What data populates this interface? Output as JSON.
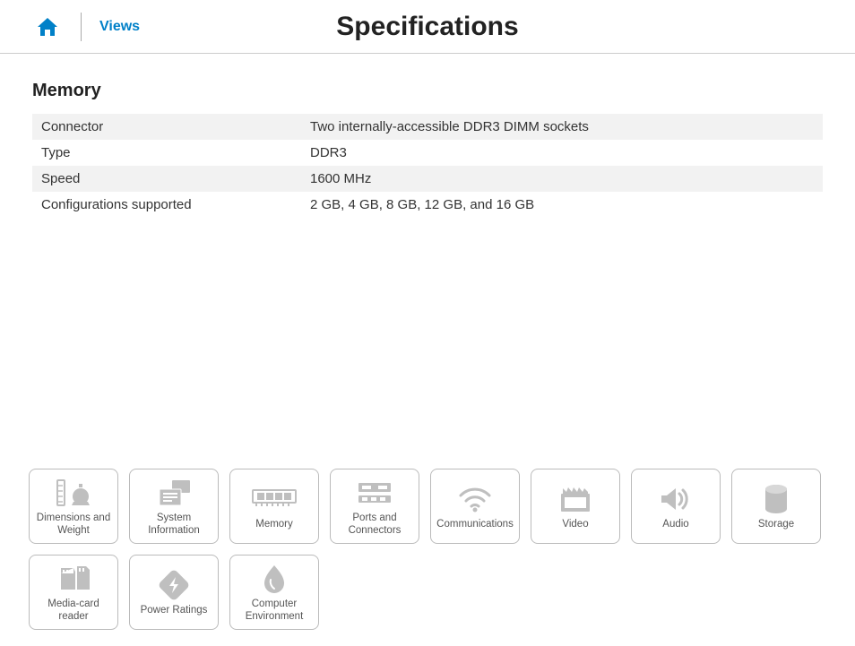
{
  "header": {
    "views_label": "Views",
    "title": "Specifications"
  },
  "section": {
    "title": "Memory",
    "rows": [
      {
        "label": "Connector",
        "value": "Two internally-accessible DDR3 DIMM sockets"
      },
      {
        "label": "Type",
        "value": "DDR3"
      },
      {
        "label": "Speed",
        "value": "1600 MHz"
      },
      {
        "label": "Configurations supported",
        "value": "2 GB, 4 GB, 8 GB, 12 GB, and 16 GB"
      }
    ]
  },
  "nav": [
    {
      "id": "dimensions",
      "label": "Dimensions and Weight"
    },
    {
      "id": "sysinfo",
      "label": "System Information"
    },
    {
      "id": "memory",
      "label": "Memory"
    },
    {
      "id": "ports",
      "label": "Ports and Connectors"
    },
    {
      "id": "comms",
      "label": "Communications"
    },
    {
      "id": "video",
      "label": "Video"
    },
    {
      "id": "audio",
      "label": "Audio"
    },
    {
      "id": "storage",
      "label": "Storage"
    },
    {
      "id": "mediacard",
      "label": "Media-card reader"
    },
    {
      "id": "power",
      "label": "Power Ratings"
    },
    {
      "id": "env",
      "label": "Computer Environment"
    }
  ]
}
